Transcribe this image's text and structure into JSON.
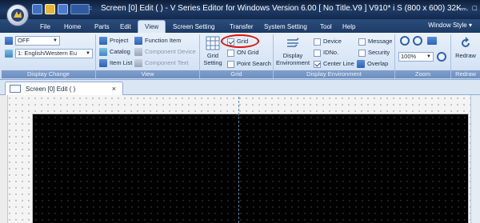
{
  "title_bar": {
    "title": "Screen [0] Edit (          ) - V Series Editor for Windows Version 6.00 [ No Title.V9 ] V910* i S (800 x 600) 32K...",
    "separator": "="
  },
  "ribbon_tabs": [
    "File",
    "Home",
    "Parts",
    "Edit",
    "View",
    "Screen Setting",
    "Transfer",
    "System Setting",
    "Tool",
    "Help"
  ],
  "active_tab": "View",
  "window_style_label": "Window Style",
  "groups": {
    "display_change": {
      "label": "Display Change",
      "onoff_value": "OFF",
      "language_value": "1: English/Western Eu"
    },
    "view": {
      "label": "View",
      "project": "Project",
      "catalog": "Catalog",
      "item_list": "Item List",
      "function_item": "Function Item",
      "component_device": "Component Device",
      "component_text": "Component Text"
    },
    "grid": {
      "label": "Grid",
      "grid_setting": "Grid Setting",
      "grid_setting_line1": "Grid",
      "grid_setting_line2": "Setting",
      "grid_checkbox": "Grid",
      "grid_checked": true,
      "on_grid": "ON Grid",
      "on_grid_checked": false,
      "point_search": "Point Search",
      "point_search_checked": false
    },
    "display_environment": {
      "label": "Display Environment",
      "display_env_line1": "Display",
      "display_env_line2": "Environment",
      "device": "Device",
      "idno": "IDNo.",
      "center_line": "Center Line",
      "center_line_checked": true,
      "message": "Message",
      "security": "Security",
      "overlap": "Overlap"
    },
    "zoom": {
      "label": "Zoom",
      "value": "100%"
    },
    "redraw": {
      "label": "Redraw",
      "button": "Redraw"
    }
  },
  "document_tab": {
    "title": "Screen [0] Edit (          )",
    "close": "×"
  },
  "colors": {
    "title_bar": "#1d3b66",
    "ribbon_bg": "#d6e4f5",
    "screen_bg": "#000000",
    "highlight_oval": "#e01010"
  }
}
